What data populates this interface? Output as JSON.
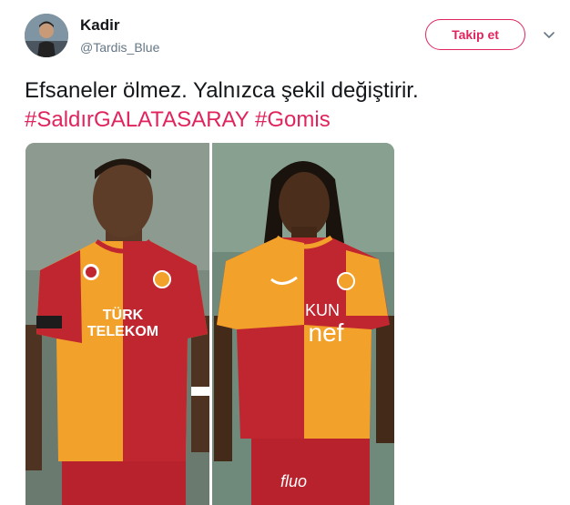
{
  "user": {
    "display_name": "Kadir",
    "handle": "@Tardis_Blue",
    "avatar_icon": "user-avatar"
  },
  "follow_button": {
    "label": "Takip et"
  },
  "menu": {
    "icon": "chevron-down-icon"
  },
  "tweet": {
    "text": "Efsaneler ölmez. Yalnızca şekil değiştirir.",
    "hashtags": [
      "#SaldırGALATASARAY",
      "#Gomis"
    ]
  },
  "media": {
    "left_photo": {
      "sponsor_line1": "TÜRK",
      "sponsor_line2": "TELEKOM"
    },
    "right_photo": {
      "sponsor_line1": "KUN",
      "sponsor_line2": "nef",
      "shorts_text": "fluo"
    }
  },
  "colors": {
    "accent": "#e0245e",
    "jersey_yellow": "#f2a22a",
    "jersey_red": "#c0262f"
  }
}
